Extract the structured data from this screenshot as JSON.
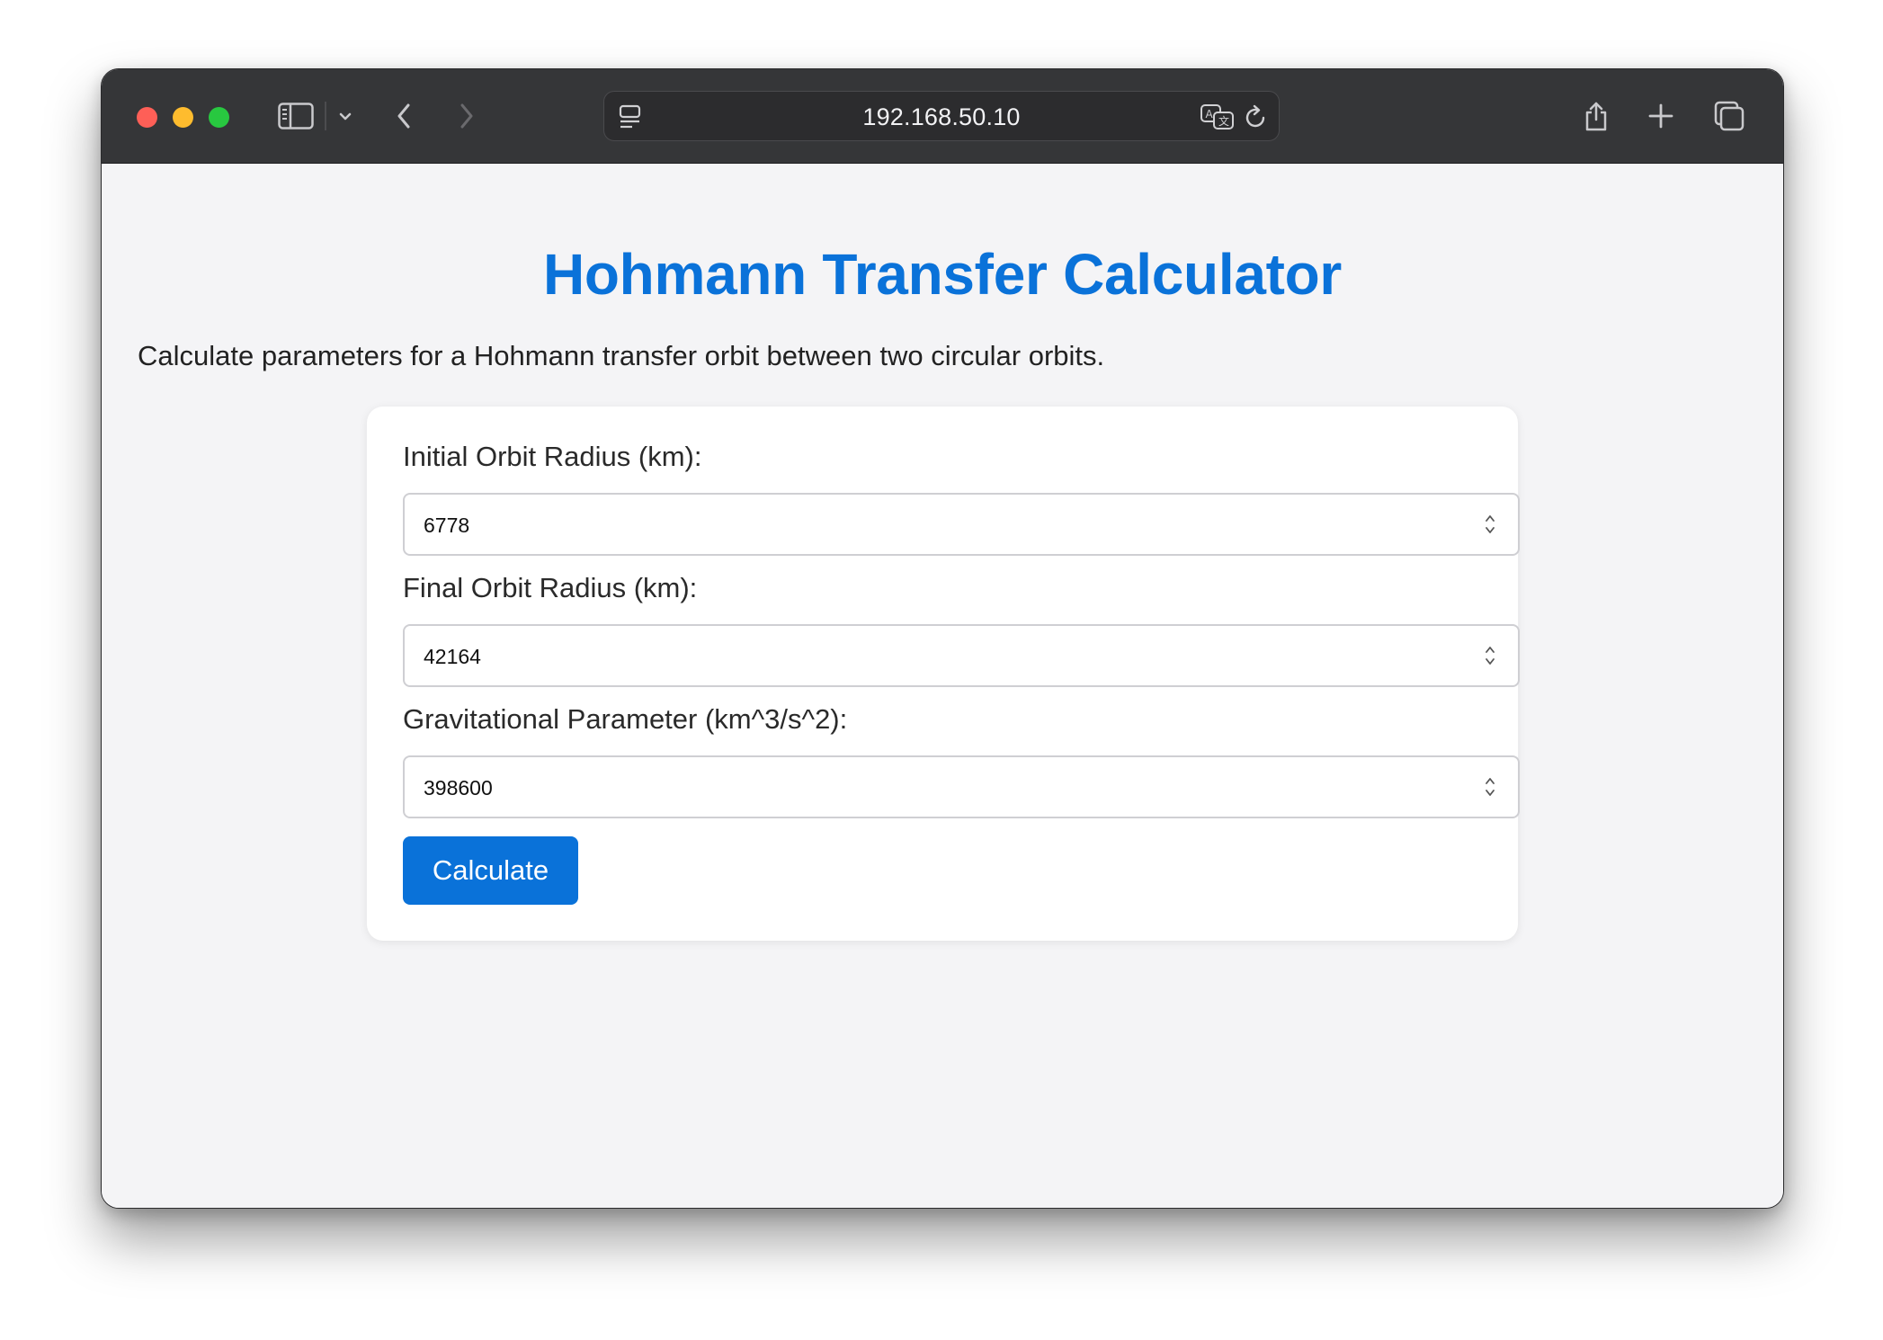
{
  "browser": {
    "url": "192.168.50.10",
    "icons": {
      "sidebar": "sidebar-toggle-icon",
      "tab_group_menu": "chevron-down-icon",
      "back": "chevron-left-icon",
      "forward": "chevron-right-icon",
      "page_menu": "page-menu-icon",
      "translate": "translate-icon",
      "reload": "reload-icon",
      "share": "share-icon",
      "new_tab": "plus-icon",
      "tab_overview": "tabs-overview-icon"
    }
  },
  "page": {
    "title": "Hohmann Transfer Calculator",
    "description": "Calculate parameters for a Hohmann transfer orbit between two circular orbits.",
    "form": {
      "initial_radius": {
        "label": "Initial Orbit Radius (km):",
        "value": "6778"
      },
      "final_radius": {
        "label": "Final Orbit Radius (km):",
        "value": "42164"
      },
      "grav_param": {
        "label": "Gravitational Parameter (km^3/s^2):",
        "value": "398600"
      },
      "submit_label": "Calculate"
    }
  },
  "colors": {
    "accent": "#0a72d9",
    "titlebar": "#353638",
    "page_background": "#f4f4f6",
    "close": "#fe5f57",
    "minimize": "#febc2e",
    "zoom": "#28c840"
  }
}
